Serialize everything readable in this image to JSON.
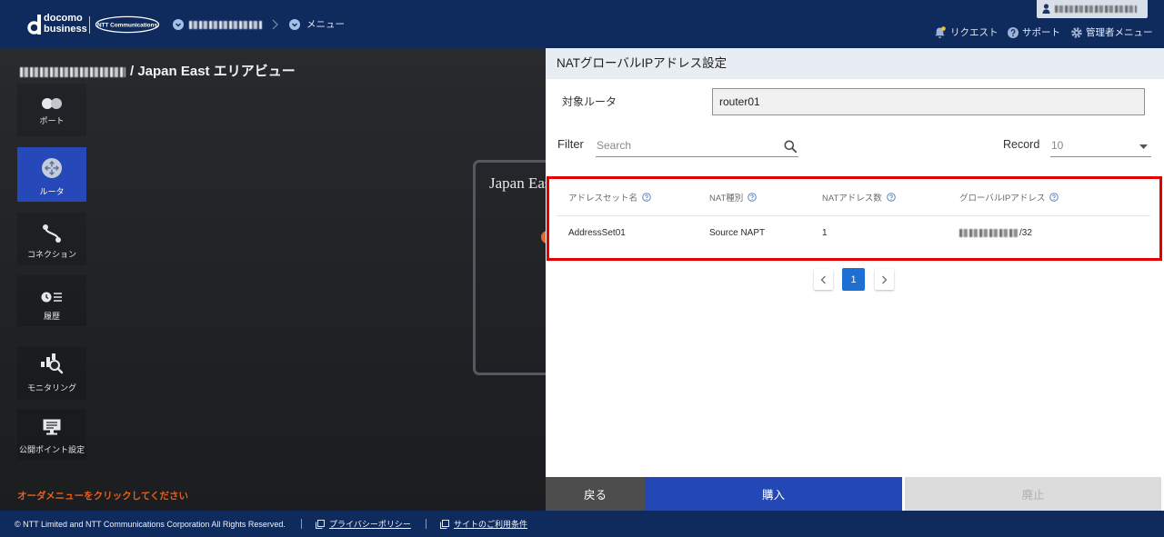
{
  "header": {
    "brand": {
      "line1": "docomo",
      "line2": "business"
    },
    "partner_logo": "NTT Communications",
    "breadcrumb_menu": "メニュー",
    "nav": {
      "request": {
        "label": "リクエスト",
        "icon": "bell-icon"
      },
      "support": {
        "label": "サポート",
        "icon": "help-icon"
      },
      "admin_menu": {
        "label": "管理者メニュー",
        "icon": "gear-icon"
      }
    }
  },
  "area": {
    "title_suffix": "/ Japan East エリアビュー",
    "region_card_title": "Japan East"
  },
  "sidebar": {
    "items": [
      {
        "label": "ポート",
        "icon": "port-icon",
        "active": false
      },
      {
        "label": "ルータ",
        "icon": "router-icon",
        "active": true
      },
      {
        "label": "コネクション",
        "icon": "connection-icon",
        "active": false
      },
      {
        "label": "履歴",
        "icon": "history-icon",
        "active": false
      },
      {
        "label": "モニタリング",
        "icon": "monitoring-icon",
        "active": false
      },
      {
        "label": "公開ポイント設定",
        "icon": "public-point-settings-icon",
        "active": false
      }
    ]
  },
  "order_hint": "オーダメニューをクリックしてください",
  "panel": {
    "title": "NATグローバルIPアドレス設定",
    "target_router": {
      "label": "対象ルータ",
      "value": "router01"
    },
    "filter": {
      "label": "Filter",
      "placeholder": "Search"
    },
    "record": {
      "label": "Record",
      "selected": "10"
    },
    "table": {
      "columns": [
        "アドレスセット名",
        "NAT種別",
        "NATアドレス数",
        "グローバルIPアドレス"
      ],
      "rows": [
        {
          "address_set": "AddressSet01",
          "nat_type": "Source NAPT",
          "nat_address_count": "1",
          "global_ip_suffix": "/32"
        }
      ]
    },
    "pagination": {
      "current_page": "1"
    },
    "buttons": {
      "back": "戻る",
      "purchase": "購入",
      "abolish": "廃止"
    }
  },
  "footer": {
    "copyright": "© NTT Limited and NTT Communications Corporation All Rights Reserved.",
    "links": [
      "プライバシーポリシー",
      "サイトのご利用条件"
    ]
  },
  "colors": {
    "header_bg": "#0f2a5c",
    "accent_blue": "#2447b6",
    "active_sidebar": "#2748b9",
    "page_active": "#1e6fd3",
    "highlight_red": "#e30000",
    "hint_orange": "#e5601d",
    "back_button": "#4d4d4d",
    "disabled_button": "#dcdcdc"
  }
}
